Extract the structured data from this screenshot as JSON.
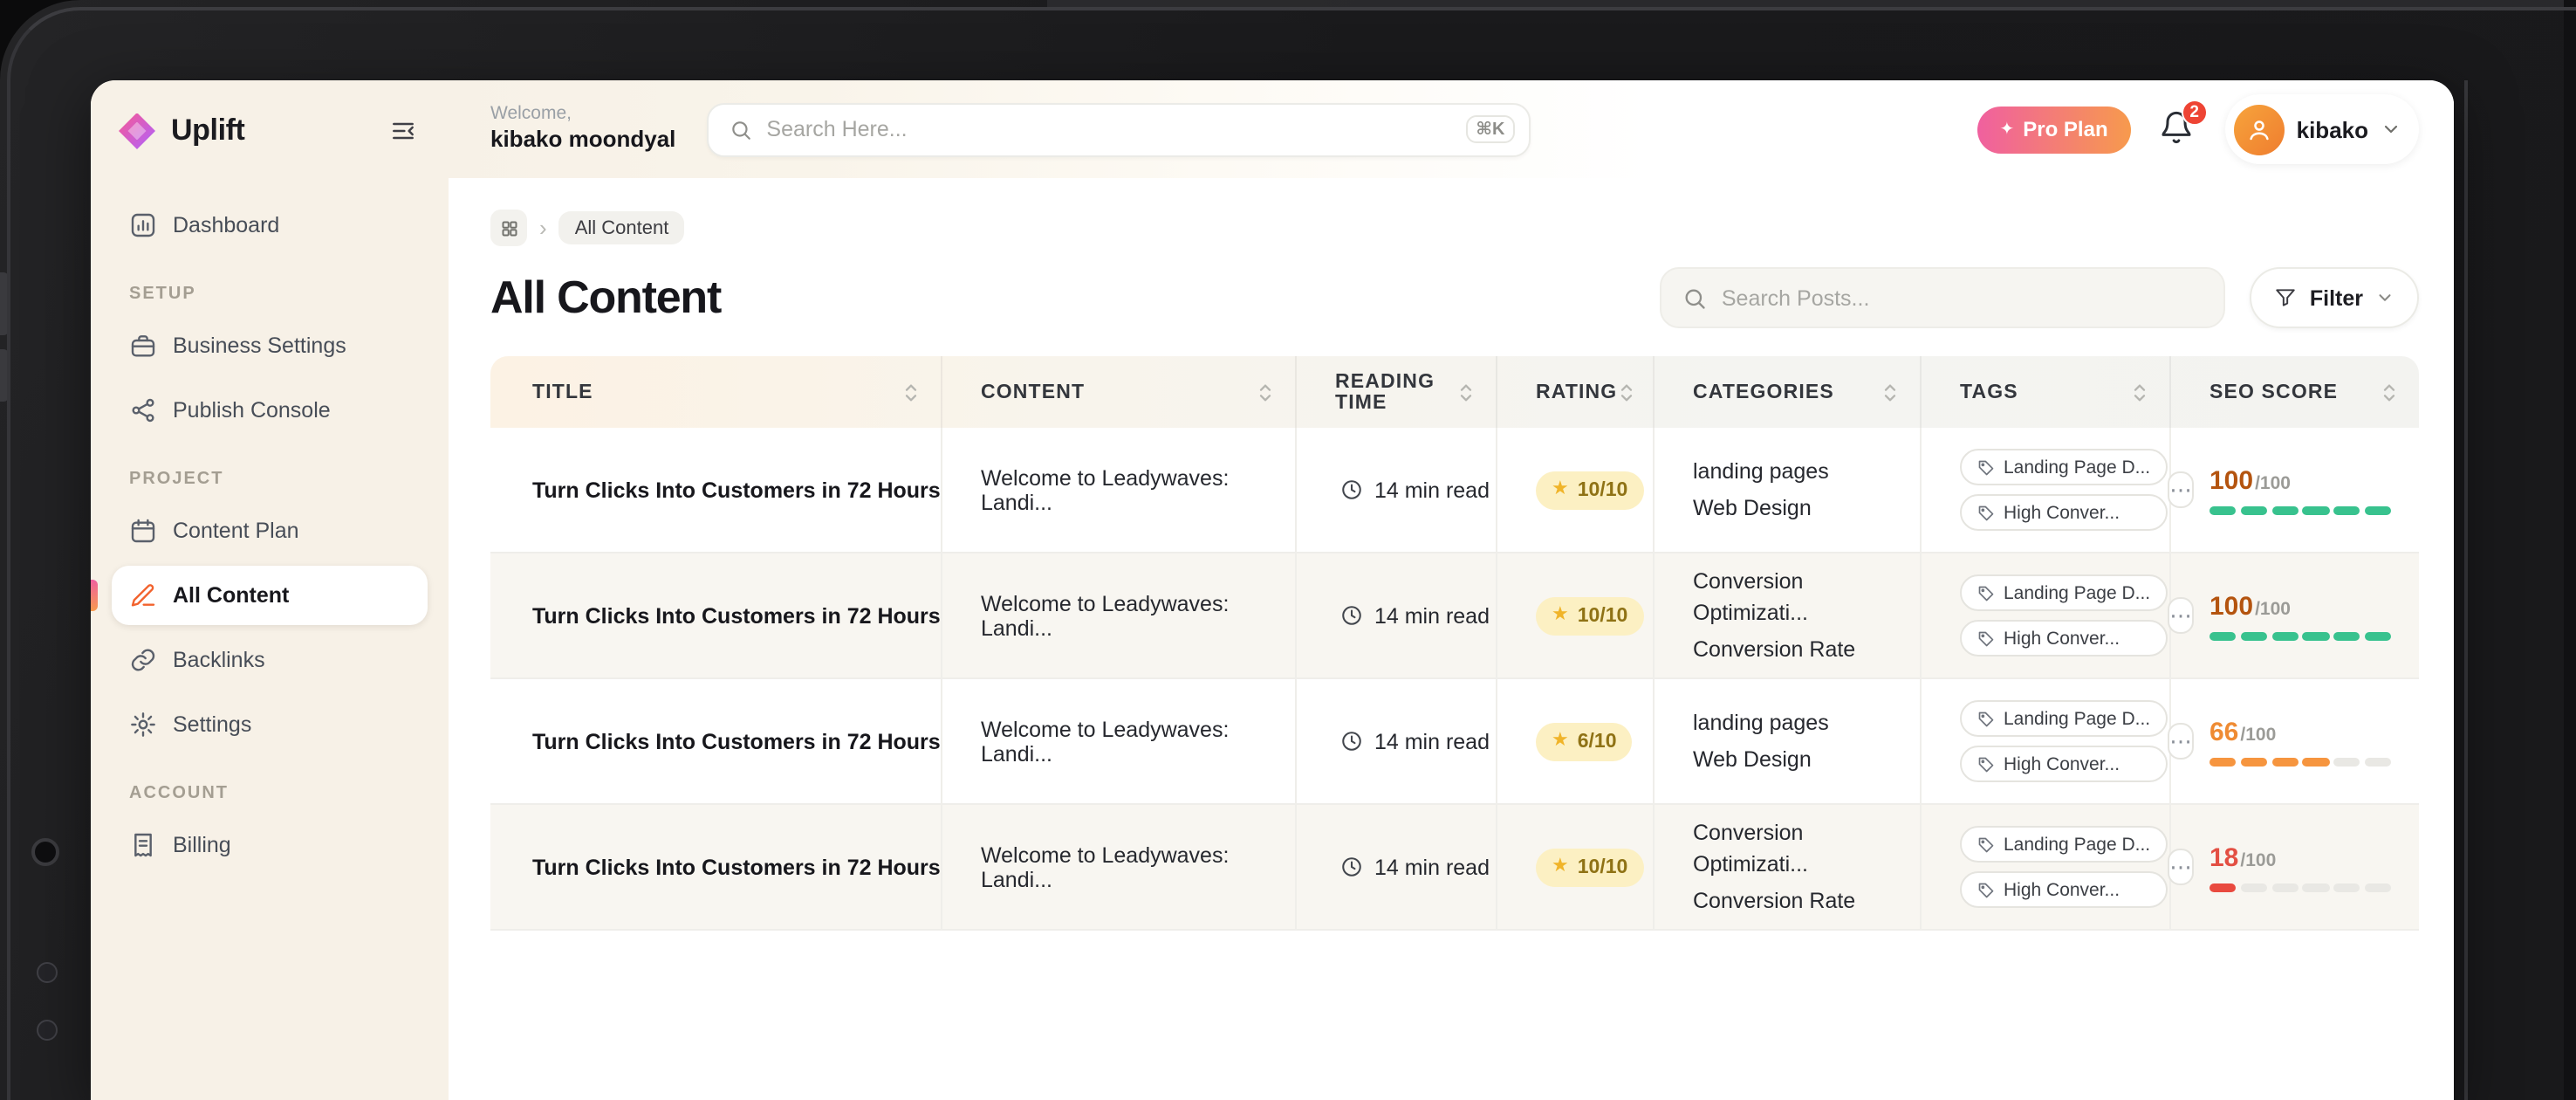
{
  "colors": {
    "sidebar_bg": "#f7f1e7",
    "accent_pink": "#f0609f",
    "accent_orange": "#f79a4d",
    "rating_bg": "#fcf0c3",
    "rating_text": "#8f7215",
    "rating_star": "#f0b429",
    "track": "#e9e8e4"
  },
  "icons": {
    "star": "★",
    "more": "⋯",
    "sparkle": "✦",
    "crumb_chevron": "›"
  },
  "sidebar": {
    "logo_text": "Uplift",
    "sections": [
      {
        "label": "",
        "items": [
          {
            "label": "Dashboard"
          }
        ]
      },
      {
        "label": "SETUP",
        "items": [
          {
            "label": "Business Settings"
          },
          {
            "label": "Publish Console"
          }
        ]
      },
      {
        "label": "PROJECT",
        "items": [
          {
            "label": "Content Plan"
          },
          {
            "label": "All Content"
          },
          {
            "label": "Backlinks"
          },
          {
            "label": "Settings"
          }
        ]
      },
      {
        "label": "ACCOUNT",
        "items": [
          {
            "label": "Billing"
          }
        ]
      }
    ]
  },
  "header": {
    "welcome_line1": "Welcome,",
    "welcome_line2": "kibako moondyal",
    "search_placeholder": "Search Here...",
    "shortcut": "⌘K",
    "pro_plan_label": "Pro Plan",
    "notification_count": "2",
    "user_name": "kibako"
  },
  "breadcrumb": {
    "current": "All Content"
  },
  "page": {
    "title": "All Content",
    "posts_search_placeholder": "Search Posts...",
    "filter_label": "Filter"
  },
  "table": {
    "columns": [
      "TITLE",
      "CONTENT",
      "READING TIME",
      "RATING",
      "CATEGORIES",
      "TAGS",
      "SEO SCORE"
    ],
    "rows": [
      {
        "title": "Turn Clicks Into Customers in 72 Hours",
        "content": "Welcome to Leadywaves: Landi...",
        "reading_time": "14 min read",
        "rating": "10/10",
        "categories": [
          "landing pages",
          "Web Design"
        ],
        "tags": [
          "Landing Page D...",
          "High Conver..."
        ],
        "seo_score": "100",
        "seo_max": "/100",
        "seo_value": 100,
        "score_color": "#b4540f",
        "bar_color": "#38c28e"
      },
      {
        "title": "Turn Clicks Into Customers in 72 Hours",
        "content": "Welcome to Leadywaves: Landi...",
        "reading_time": "14 min read",
        "rating": "10/10",
        "categories": [
          "Conversion Optimizati...",
          "Conversion Rate"
        ],
        "tags": [
          "Landing Page D...",
          "High Conver..."
        ],
        "seo_score": "100",
        "seo_max": "/100",
        "seo_value": 100,
        "score_color": "#b4540f",
        "bar_color": "#38c28e"
      },
      {
        "title": "Turn Clicks Into Customers in 72 Hours",
        "content": "Welcome to Leadywaves: Landi...",
        "reading_time": "14 min read",
        "rating": "6/10",
        "categories": [
          "landing pages",
          "Web Design"
        ],
        "tags": [
          "Landing Page D...",
          "High Conver..."
        ],
        "seo_score": "66",
        "seo_max": "/100",
        "seo_value": 66,
        "score_color": "#ef8b33",
        "bar_color": "#f6953f"
      },
      {
        "title": "Turn Clicks Into Customers in 72 Hours",
        "content": "Welcome to Leadywaves: Landi...",
        "reading_time": "14 min read",
        "rating": "10/10",
        "categories": [
          "Conversion Optimizati...",
          "Conversion Rate"
        ],
        "tags": [
          "Landing Page D...",
          "High Conver..."
        ],
        "seo_score": "18",
        "seo_max": "/100",
        "seo_value": 18,
        "score_color": "#e34f43",
        "bar_color": "#e94a3f"
      }
    ]
  }
}
